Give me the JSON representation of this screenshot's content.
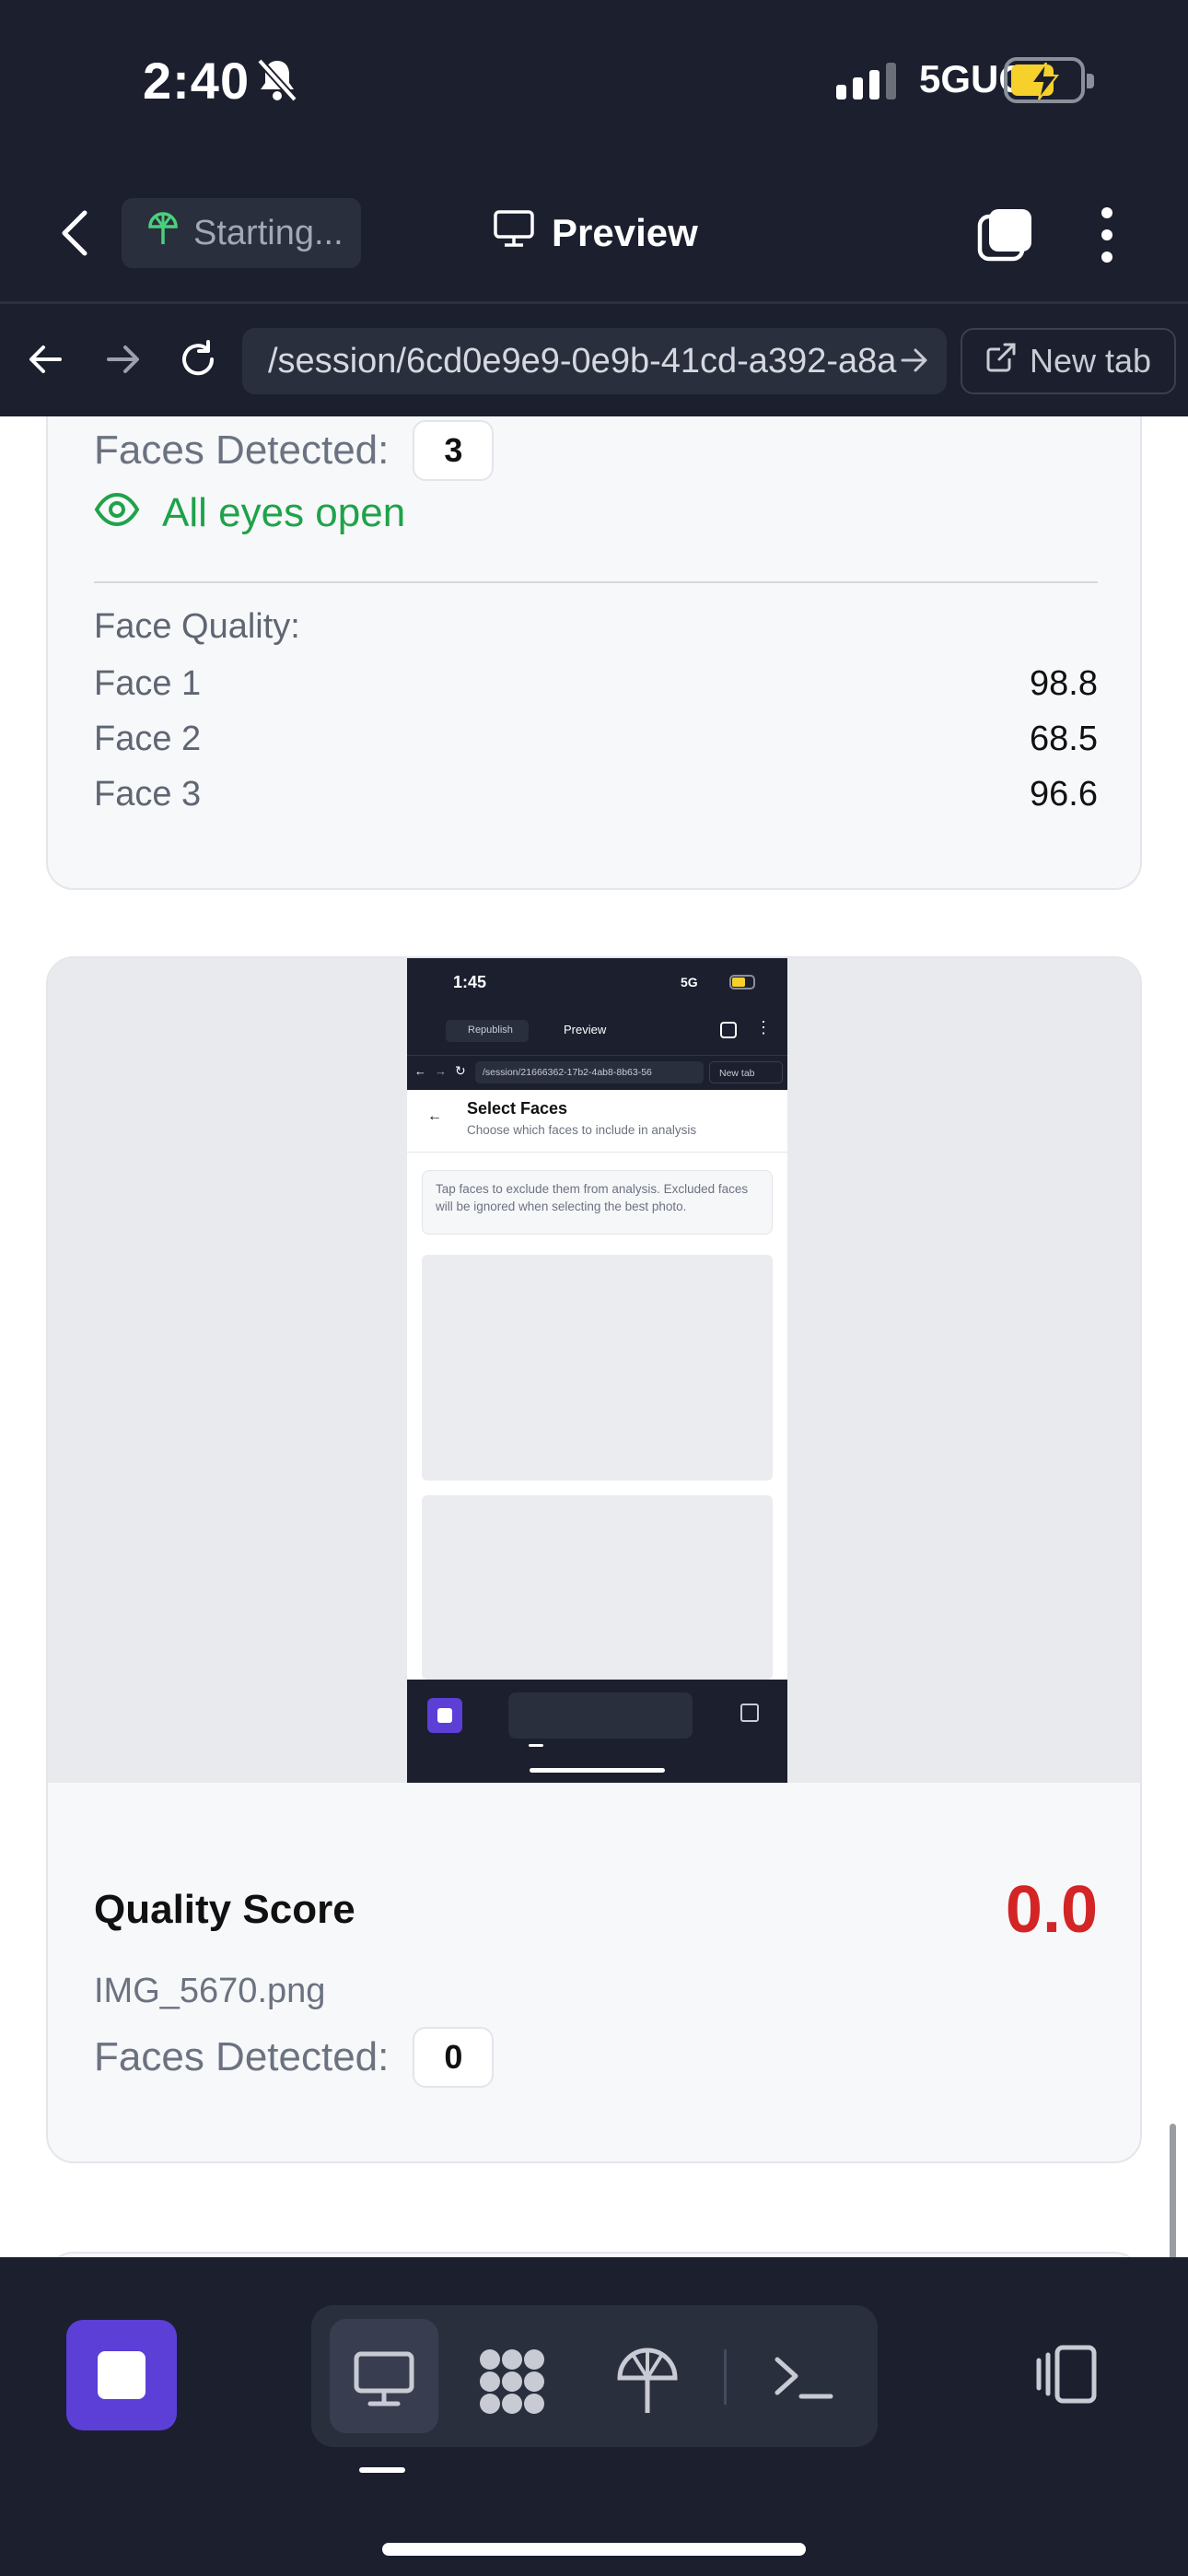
{
  "status_bar": {
    "time": "2:40",
    "network": "5GUC",
    "icons": [
      "bell-slash-icon",
      "signal-icon",
      "battery-charging-icon"
    ]
  },
  "app_bar": {
    "status_pill": "Starting...",
    "title": "Preview",
    "icons": [
      "chevron-left-icon",
      "umbrella-icon",
      "monitor-icon",
      "tabs-icon",
      "more-vertical-icon"
    ]
  },
  "url_bar": {
    "url": "/session/6cd0e9e9-0e9b-41cd-a392-a8a",
    "new_tab_label": "New tab"
  },
  "card1": {
    "faces_label": "Faces Detected:",
    "faces_count": "3",
    "eyes_status": "All eyes open",
    "face_quality_title": "Face Quality:",
    "faces": [
      {
        "label": "Face 1",
        "value": "98.8"
      },
      {
        "label": "Face 2",
        "value": "68.5"
      },
      {
        "label": "Face 3",
        "value": "96.6"
      }
    ]
  },
  "card2": {
    "thumbnail": {
      "time": "1:45",
      "network": "5G",
      "pill": "Republish",
      "title": "Preview",
      "url": "/session/21666362-17b2-4ab8-8b63-56",
      "new_tab": "New tab",
      "page_title": "Select Faces",
      "page_subtitle": "Choose which faces to include in analysis",
      "tip": "Tap faces to exclude them from analysis. Excluded faces will be ignored when selecting the best photo."
    },
    "score_label": "Quality Score",
    "score_value": "0.0",
    "filename": "IMG_5670.png",
    "faces_label": "Faces Detected:",
    "faces_count": "0"
  },
  "colors": {
    "dark_bg": "#1b1f2e",
    "accent_purple": "#5b3fd6",
    "success_green": "#1fa24a",
    "score_red": "#d32525"
  },
  "bottom_bar": {
    "icons": [
      "stop-icon",
      "monitor-icon",
      "hub-icon",
      "umbrella-icon",
      "terminal-icon",
      "layout-icon"
    ]
  }
}
